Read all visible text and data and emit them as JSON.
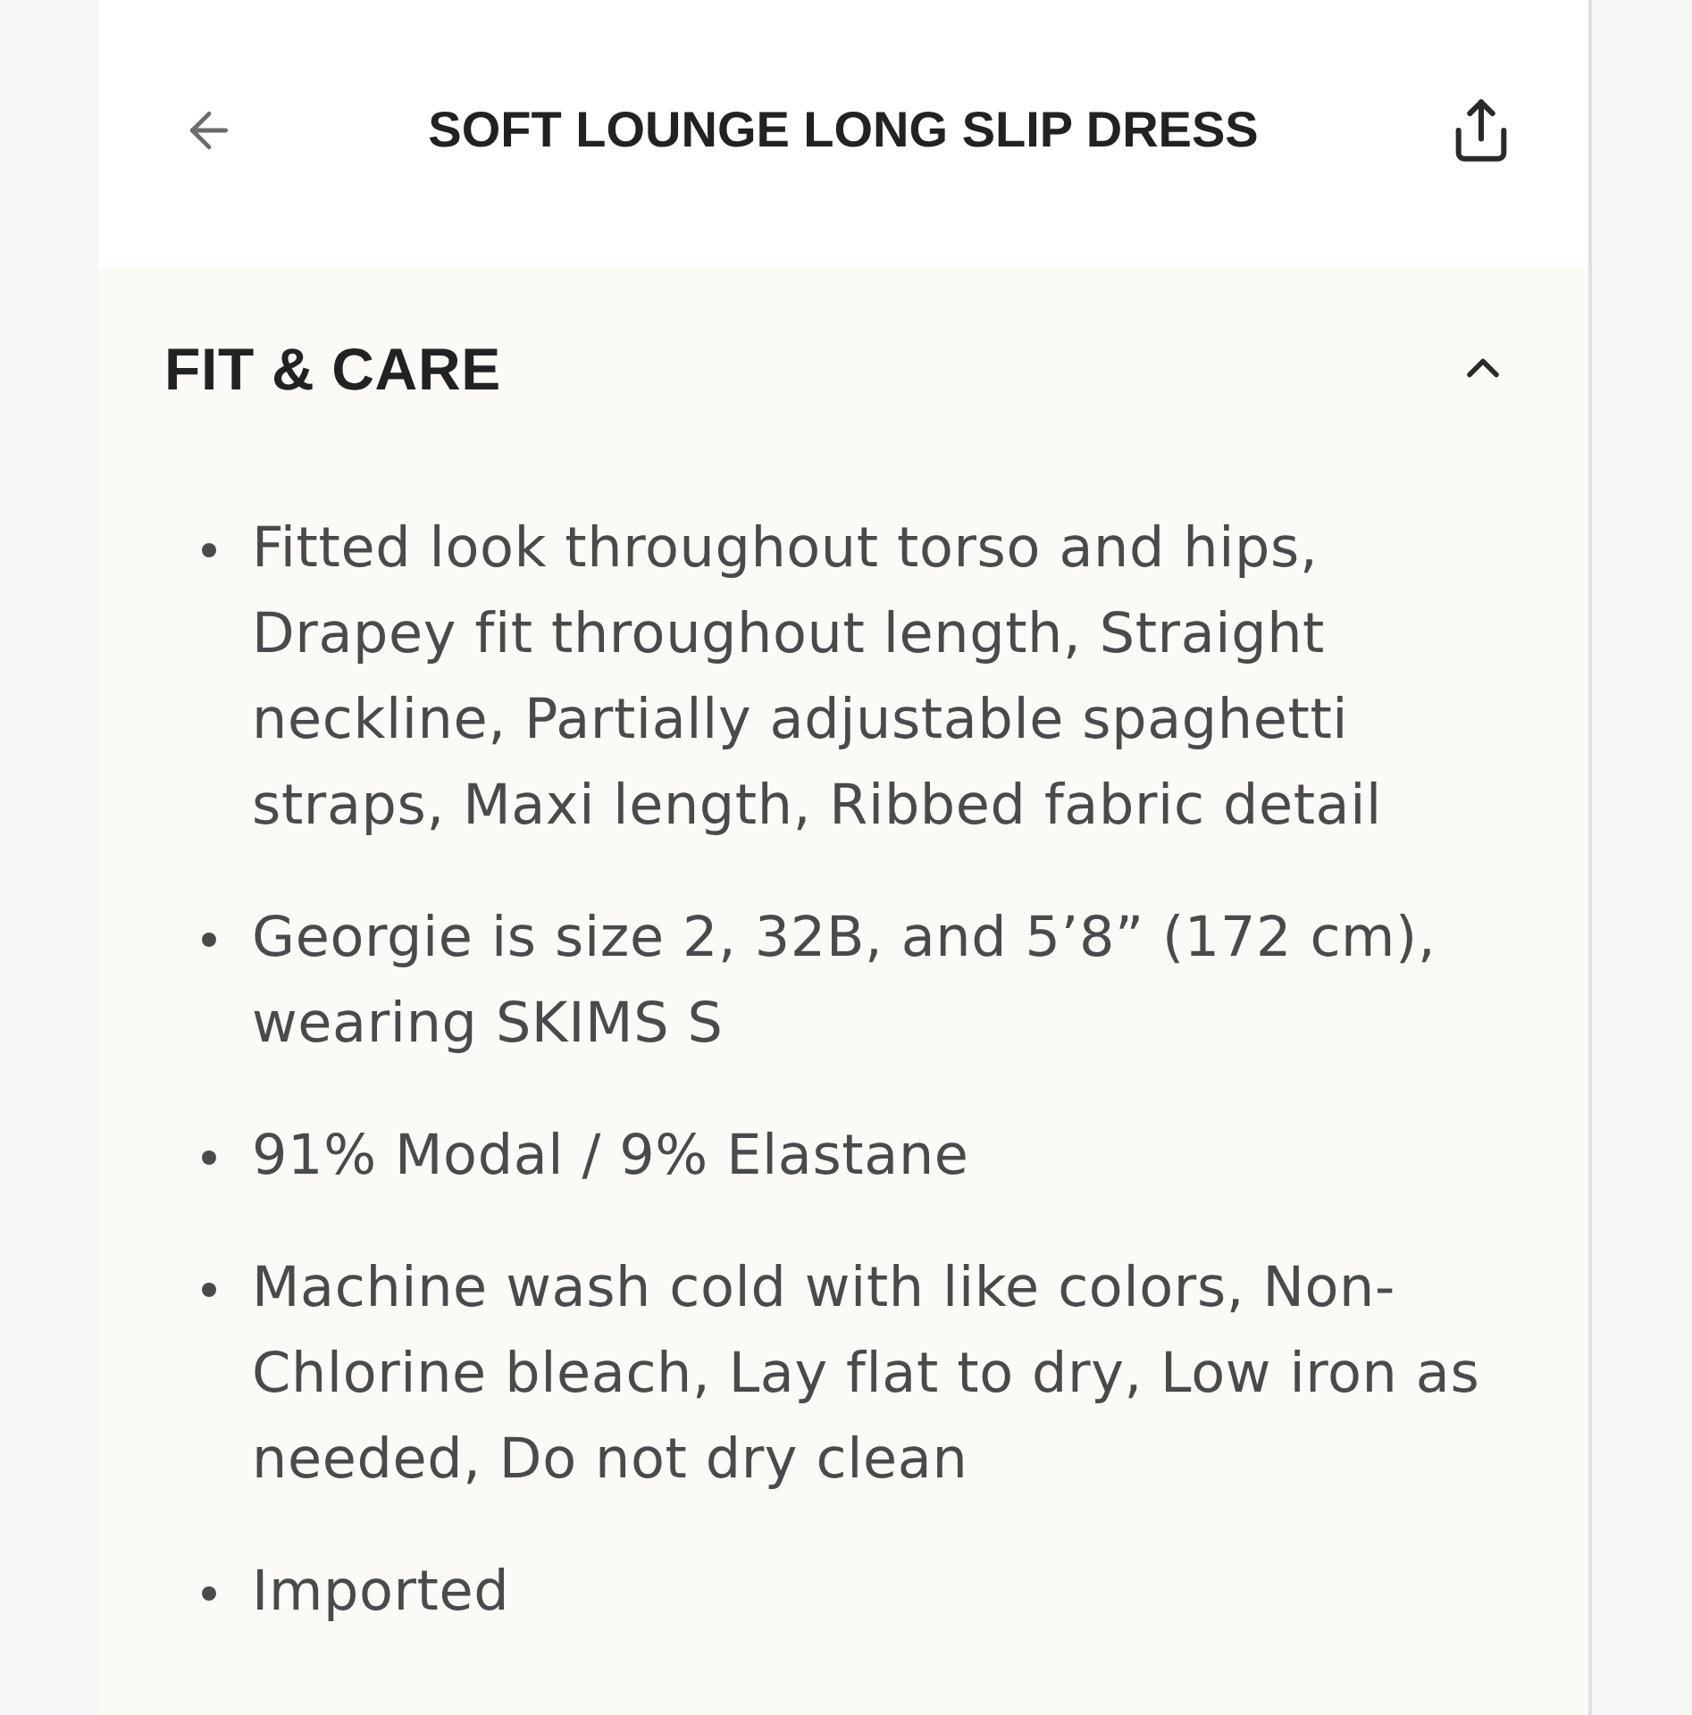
{
  "header": {
    "title": "SOFT LOUNGE LONG SLIP DRESS"
  },
  "section": {
    "title": "FIT & CARE",
    "expanded": true,
    "items": [
      "Fitted look throughout torso and hips, Drapey fit throughout length, Straight neckline, Partially adjustable spaghetti straps, Maxi length, Ribbed fabric detail",
      "Georgie is size 2, 32B, and 5’8” (172 cm), wearing SKIMS S",
      "91% Modal / 9% Elastane",
      "Machine wash cold with like colors, Non-Chlorine bleach, Lay flat to dry, Low iron as needed, Do not dry clean",
      "Imported"
    ]
  }
}
